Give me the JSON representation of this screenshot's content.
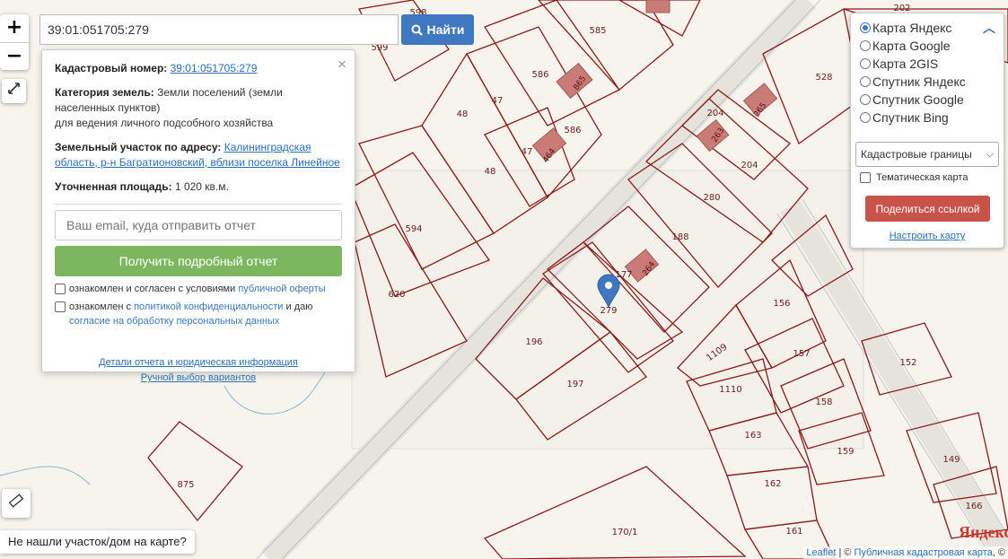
{
  "search": {
    "value": "39:01:051705:279",
    "button_label": "Найти"
  },
  "zoom": {
    "in_label": "+",
    "out_label": "−"
  },
  "popup": {
    "close_label": "×",
    "cadastral_label": "Кадастровый номер:",
    "cadastral_value": "39:01:051705:279",
    "category_label": "Категория земель:",
    "category_value": "Земли поселений (земли населенных пунктов)",
    "category_use": "для ведения личного подсобного хозяйства",
    "address_label": "Земельный участок по адресу:",
    "address_value": "Калининградская область, р-н Багратионовский, вблизи поселка Линейное",
    "area_label": "Уточненная площадь:",
    "area_value": "1 020 кв.м.",
    "email_placeholder": "Ваш email, куда отправить отчет",
    "get_report_label": "Получить подробный отчет",
    "consent1_prefix": "ознакомлен и согласен с условиями",
    "consent1_link": "публичной оферты",
    "consent2_prefix": "ознакомлен с",
    "consent2_link": "политикой конфиденциальности",
    "consent2_mid": "и даю",
    "consent2_link2": "согласие на обработку персональных данных",
    "details_link": "Детали отчета и юридическая информация",
    "manual_link": "Ручной выбор вариантов"
  },
  "layers": {
    "options": [
      "Карта Яндекс",
      "Карта Google",
      "Карта 2GIS",
      "Спутник Яндекс",
      "Спутник Google",
      "Спутник Bing"
    ],
    "selected_index": 0,
    "select_value": "Кадастровые границы",
    "thematic_label": "Тематическая карта",
    "share_label": "Поделиться ссылкой",
    "customize_label": "Настроить карту"
  },
  "not_found_label": "Не нашли участок/дом на карте?",
  "attribution": {
    "leaflet": "Leaflet",
    "sep": "| ©",
    "pkk": "Публичная кадастровая карта",
    "tail": ", ©"
  },
  "map": {
    "parcel_labels": [
      "598",
      "599",
      "585",
      "586",
      "202",
      "528",
      "47",
      "48",
      "47",
      "48",
      "586",
      "204",
      "204",
      "594",
      "620",
      "280",
      "188",
      "177",
      "279",
      "196",
      "197",
      "156",
      "157",
      "158",
      "1109",
      "1110",
      "152",
      "163",
      "159",
      "162",
      "161",
      "149",
      "166",
      "875",
      "170/1"
    ],
    "building_labels": [
      "865",
      "464",
      "265",
      "263",
      "264"
    ],
    "yandex_logo": "Яндекс",
    "marker_parcel": "279"
  },
  "colors": {
    "boundary": "#8b1a1a",
    "building": "#c97b78",
    "road": "#e8e6e0",
    "accent": "#3f78c0",
    "green_btn": "#7cb760",
    "share_btn": "#c9534a"
  }
}
